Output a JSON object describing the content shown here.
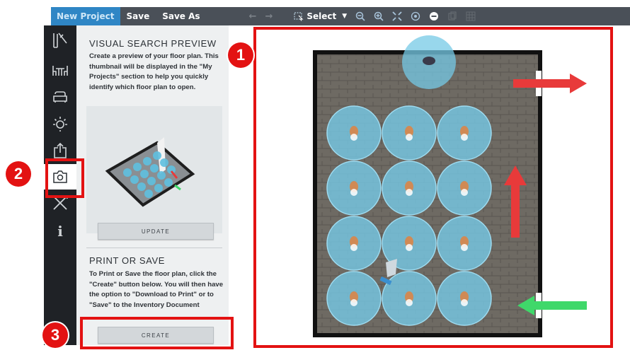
{
  "toolbar": {
    "tab_new_project": "New Project",
    "save": "Save",
    "save_as": "Save As",
    "select_label": "Select"
  },
  "panel": {
    "section1_title": "VISUAL SEARCH PREVIEW",
    "section1_desc": "Create a preview of your floor plan. This thumbnail will be displayed in the \"My Projects\" section to help you quickly identify which floor plan to open.",
    "update_button": "UPDATE",
    "section2_title": "PRINT OR SAVE",
    "section2_desc": "To Print or Save the floor plan, click the \"Create\" button below. You will then have the option to \"Download to Print\" or to \"Save\" to the Inventory Document",
    "create_button": "CREATE"
  },
  "callouts": [
    "1",
    "2",
    "3"
  ],
  "colors": {
    "highlight": "#e31212",
    "accent_tab": "#2f86c5",
    "sidebar_bg": "#1f2226",
    "floor": "#6e6a63",
    "seat_bubble": "#76c9e6",
    "exit_arrow": "#e83a3a",
    "entry_arrow": "#3fd86a"
  },
  "sidebar_icons": [
    "floorplan-icon",
    "furniture-table-icon",
    "sofa-icon",
    "light-icon",
    "export-icon",
    "camera-icon",
    "tools-icon",
    "info-icon"
  ]
}
